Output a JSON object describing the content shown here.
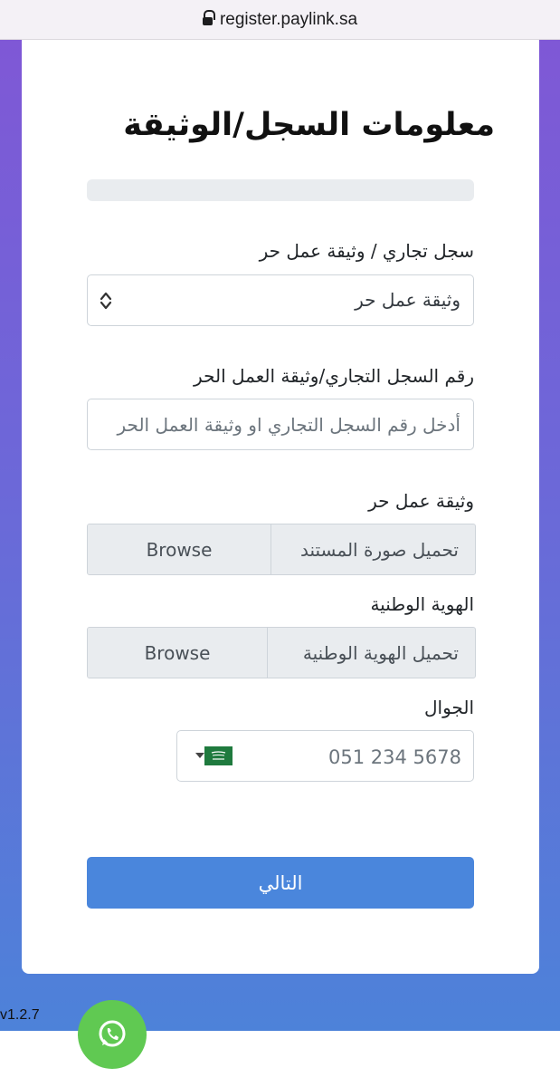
{
  "browser": {
    "url": "register.paylink.sa"
  },
  "page": {
    "title": "معلومات السجل/الوثيقة",
    "progress_percent": 0
  },
  "form": {
    "doc_type": {
      "label": "سجل تجاري / وثيقة عمل حر",
      "selected": "وثيقة عمل حر"
    },
    "doc_number": {
      "label": "رقم السجل التجاري/وثيقة العمل الحر",
      "placeholder": "أدخل رقم السجل التجاري او وثيقة العمل الحر"
    },
    "doc_upload": {
      "label": "وثيقة عمل حر",
      "text": "تحميل صورة المستند",
      "browse": "Browse"
    },
    "id_upload": {
      "label": "الهوية الوطنية",
      "text": "تحميل الهوية الوطنية",
      "browse": "Browse"
    },
    "mobile": {
      "label": "الجوال",
      "value": "051 234 5678",
      "country_flag": "saudi-arabia-flag"
    },
    "next_button": "التالي"
  },
  "footer": {
    "version": "v1.2.7",
    "chat_icon": "whatsapp-icon"
  },
  "colors": {
    "gradient_top": "#7f58d6",
    "gradient_bottom": "#4d82d9",
    "primary_button": "#4a86dc",
    "whatsapp": "#60c952"
  }
}
